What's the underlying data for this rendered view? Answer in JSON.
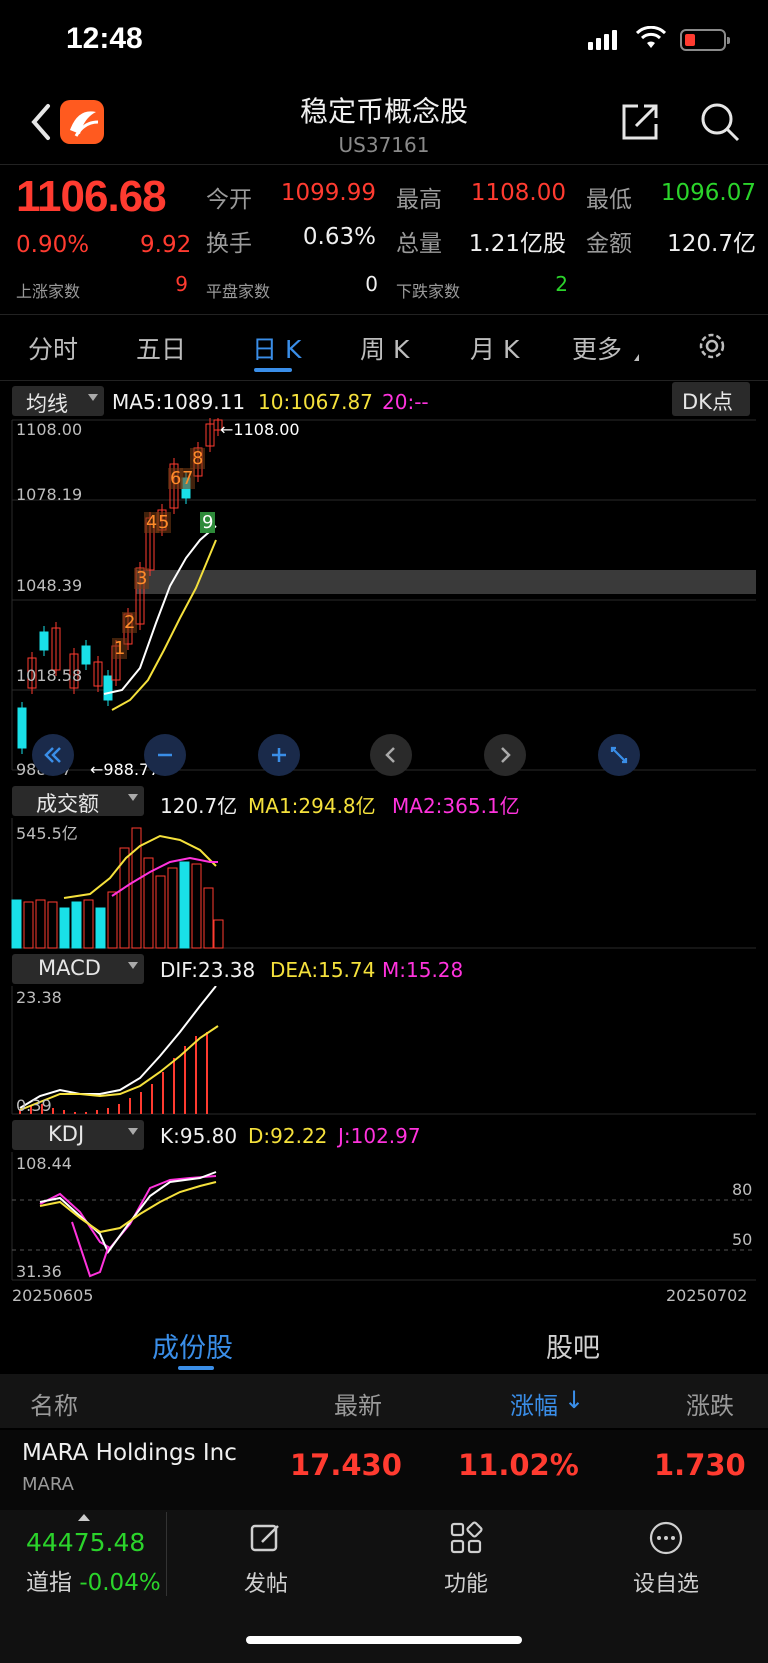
{
  "status": {
    "time": "12:48"
  },
  "header": {
    "title": "稳定币概念股",
    "code": "US37161"
  },
  "quote": {
    "price": "1106.68",
    "change_pct": "0.90%",
    "change": "9.92",
    "open_label": "今开",
    "open": "1099.99",
    "high_label": "最高",
    "high": "1108.00",
    "low_label": "最低",
    "low": "1096.07",
    "turnover_label": "换手",
    "turnover": "0.63%",
    "volume_label": "总量",
    "volume": "1.21亿股",
    "amount_label": "金额",
    "amount": "120.7亿",
    "up_label": "上涨家数",
    "up_count": "9",
    "flat_label": "平盘家数",
    "flat_count": "0",
    "down_label": "下跌家数",
    "down_count": "2"
  },
  "tabs": [
    "分时",
    "五日",
    "日 K",
    "周 K",
    "月 K",
    "更多"
  ],
  "kline": {
    "ma_selector": "均线",
    "ma5": "MA5:1089.11",
    "ma10": "10:1067.87",
    "ma20": "20:--",
    "dk_button": "DK点",
    "y_labels": [
      "1108.00",
      "1078.19",
      "1048.39",
      "1018.58",
      "988.77"
    ],
    "high_marker": "1108.00",
    "low_marker": "988.77",
    "counts": [
      "1",
      "2",
      "3",
      "4",
      "5",
      "6",
      "7",
      "8",
      "9"
    ]
  },
  "volume": {
    "selector": "成交额",
    "value": "120.7亿",
    "ma1": "MA1:294.8亿",
    "ma2": "MA2:365.1亿",
    "y_max": "545.5亿"
  },
  "macd": {
    "selector": "MACD",
    "dif": "DIF:23.38",
    "dea": "DEA:15.74",
    "m": "M:15.28",
    "y_max": "23.38",
    "y_min": "0.39"
  },
  "kdj": {
    "selector": "KDJ",
    "k": "K:95.80",
    "d": "D:92.22",
    "j": "J:102.97",
    "y_max": "108.44",
    "y_min": "31.36",
    "level_high": "80",
    "level_low": "50",
    "date_start": "20250605",
    "date_end": "20250702"
  },
  "section_tabs": [
    "成份股",
    "股吧"
  ],
  "list": {
    "headers": {
      "name": "名称",
      "latest": "最新",
      "pct": "涨幅",
      "change": "涨跌"
    },
    "rows": [
      {
        "name": "MARA Holdings Inc",
        "ticker": "MARA",
        "latest": "17.430",
        "pct": "11.02%",
        "change": "1.730"
      }
    ]
  },
  "bottom": {
    "index_value": "44475.48",
    "index_name": "道指",
    "index_change": "-0.04%",
    "nav": [
      "发帖",
      "功能",
      "设自选"
    ]
  },
  "colors": {
    "up": "#ff3b30",
    "down": "#2bd42b",
    "accent": "#3a8ee8",
    "cyan": "#19e0e8"
  }
}
